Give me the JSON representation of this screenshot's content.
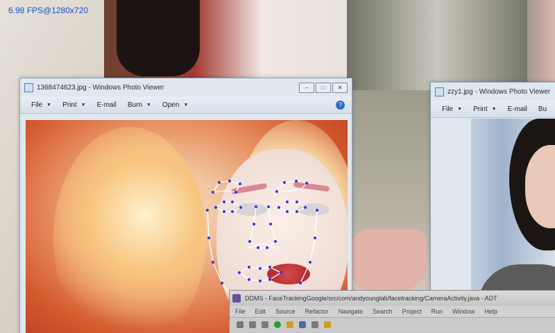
{
  "fps_overlay": "6.98 FPS@1280x720",
  "window_main": {
    "title": "1368474623.jpg - Windows Photo Viewer",
    "menus": [
      {
        "label": "File"
      },
      {
        "label": "Print"
      },
      {
        "label": "E-mail"
      },
      {
        "label": "Burn"
      },
      {
        "label": "Open"
      }
    ],
    "help": "?"
  },
  "window_secondary": {
    "title": "zzy1.jpg - Windows Photo Viewer",
    "menus": [
      {
        "label": "File"
      },
      {
        "label": "Print"
      },
      {
        "label": "E-mail"
      },
      {
        "label": "Bu"
      }
    ]
  },
  "ide": {
    "title": "DDMS - FaceTrackingGoogle/src/com/andyounglab/facetracking/CameraActivity.java - ADT",
    "menus": [
      "File",
      "Edit",
      "Source",
      "Refactor",
      "Navigate",
      "Search",
      "Project",
      "Run",
      "Window",
      "Help"
    ]
  },
  "colors": {
    "fps_text": "#1b4cd0",
    "landmark_line": "#ffffff",
    "landmark_point": "#2b3bd6"
  },
  "icons": [
    "photo-viewer-icon",
    "minimize-icon",
    "maximize-icon",
    "close-icon",
    "help-icon",
    "eclipse-icon"
  ]
}
